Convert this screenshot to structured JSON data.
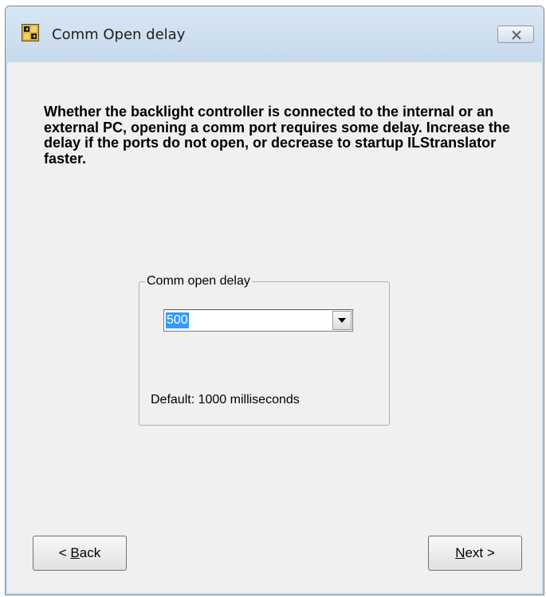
{
  "window": {
    "title": "Comm Open delay",
    "app_icon": "app-grid-icon",
    "close_icon": "close-icon"
  },
  "description": "Whether the backlight controller is connected to the internal or an external PC, opening a comm port requires some delay. Increase the delay if the ports do not open, or decrease to startup ILStranslator faster.",
  "group": {
    "label": "Comm open delay",
    "combo_value": "500",
    "default_text": "Default: 1000 milliseconds"
  },
  "buttons": {
    "back_prefix": "< ",
    "back_accel": "B",
    "back_rest": "ack",
    "next_accel": "N",
    "next_rest": "ext >"
  },
  "colors": {
    "selection": "#3399ff",
    "dialog_bg": "#f0f0f0",
    "frame": "#c2d6ea"
  }
}
